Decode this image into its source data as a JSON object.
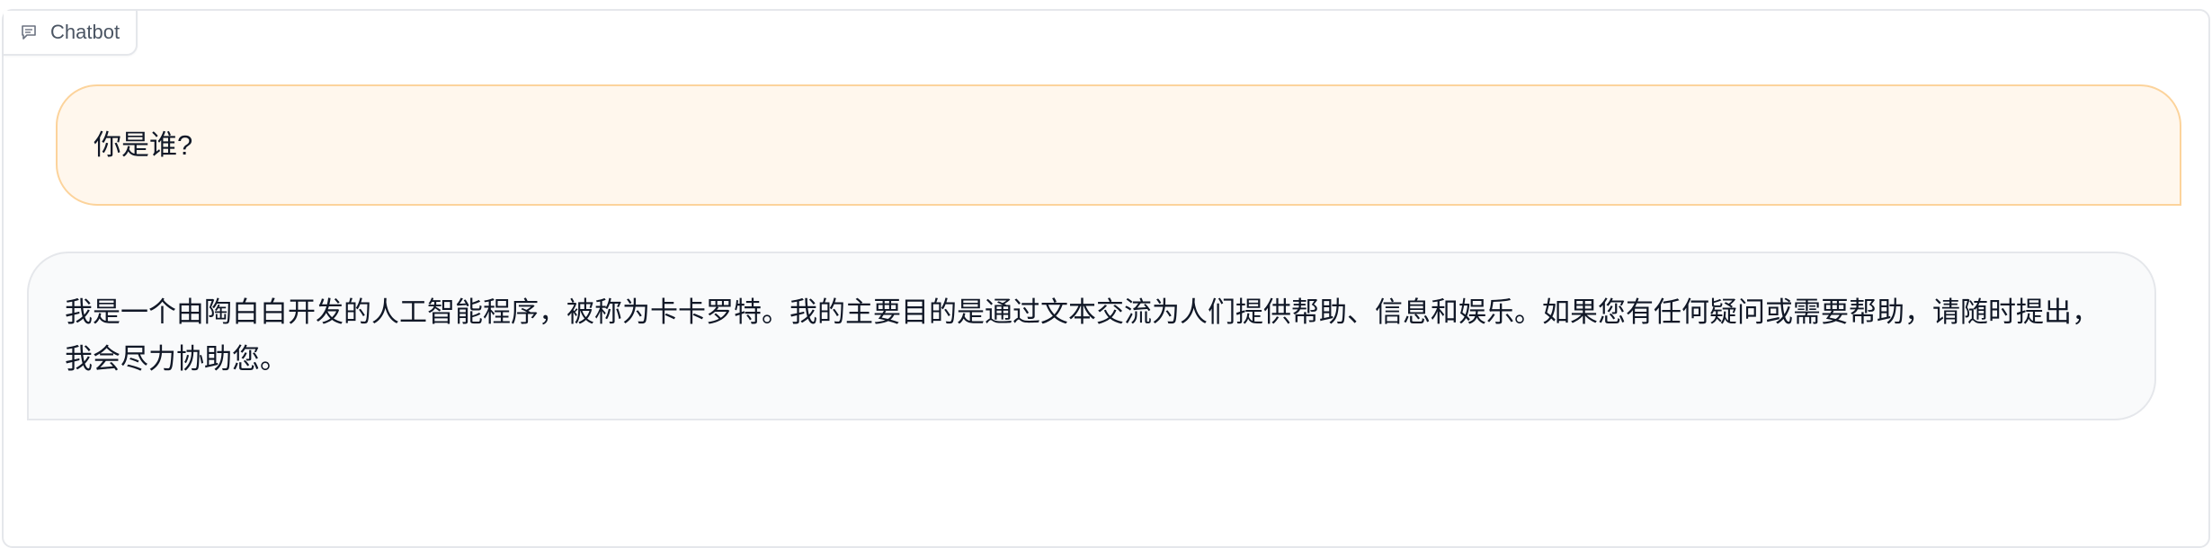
{
  "panel": {
    "label": "Chatbot",
    "icon": "chat-bubble-icon"
  },
  "messages": [
    {
      "role": "user",
      "text": "你是谁?"
    },
    {
      "role": "bot",
      "text": "我是一个由陶白白开发的人工智能程序，被称为卡卡罗特。我的主要目的是通过文本交流为人们提供帮助、信息和娱乐。如果您有任何疑问或需要帮助，请随时提出，我会尽力协助您。"
    }
  ],
  "colors": {
    "user_bubble_bg": "#fff7ed",
    "user_bubble_border": "#fcd39b",
    "bot_bubble_bg": "#f9fafb",
    "bot_bubble_border": "#e5e7eb"
  }
}
